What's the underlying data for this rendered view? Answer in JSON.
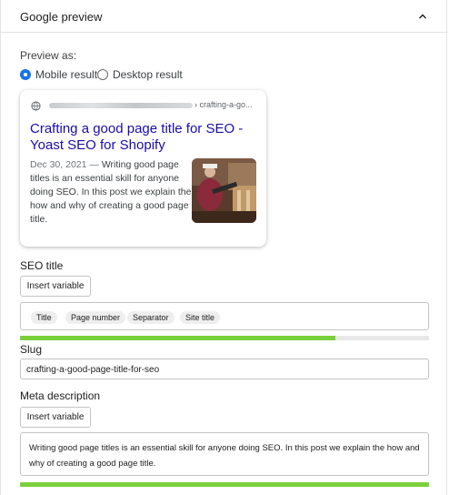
{
  "header": {
    "title": "Google preview",
    "collapse_icon": "chevron-up-icon"
  },
  "preview": {
    "label": "Preview as:",
    "options": [
      {
        "label": "Mobile result",
        "selected": true
      },
      {
        "label": "Desktop result",
        "selected": false
      }
    ]
  },
  "serp": {
    "breadcrumb": "› crafting-a-go...",
    "title": "Crafting a good page title for SEO - Yoast SEO for Shopify",
    "date": "Dec 30, 2021",
    "separator": "—",
    "description": "Writing good page titles is an essential skill for anyone doing SEO. In this post we explain the how and why of creating a good page title.",
    "link_color": "#1a0dab",
    "favicon_icon": "globe-icon"
  },
  "seo_title": {
    "label": "SEO title",
    "insert_variable": "Insert variable",
    "variables": [
      "Title",
      "Page number",
      "Separator",
      "Site title"
    ],
    "score_percent": 77,
    "score_color": "#7ad03a"
  },
  "slug": {
    "label": "Slug",
    "value": "crafting-a-good-page-title-for-seo"
  },
  "meta_description": {
    "label": "Meta description",
    "insert_variable": "Insert variable",
    "value": "Writing good page titles is an essential skill for anyone doing SEO. In this post we explain the how and why of creating a good page title.",
    "score_percent": 100,
    "score_color": "#7ad03a"
  }
}
